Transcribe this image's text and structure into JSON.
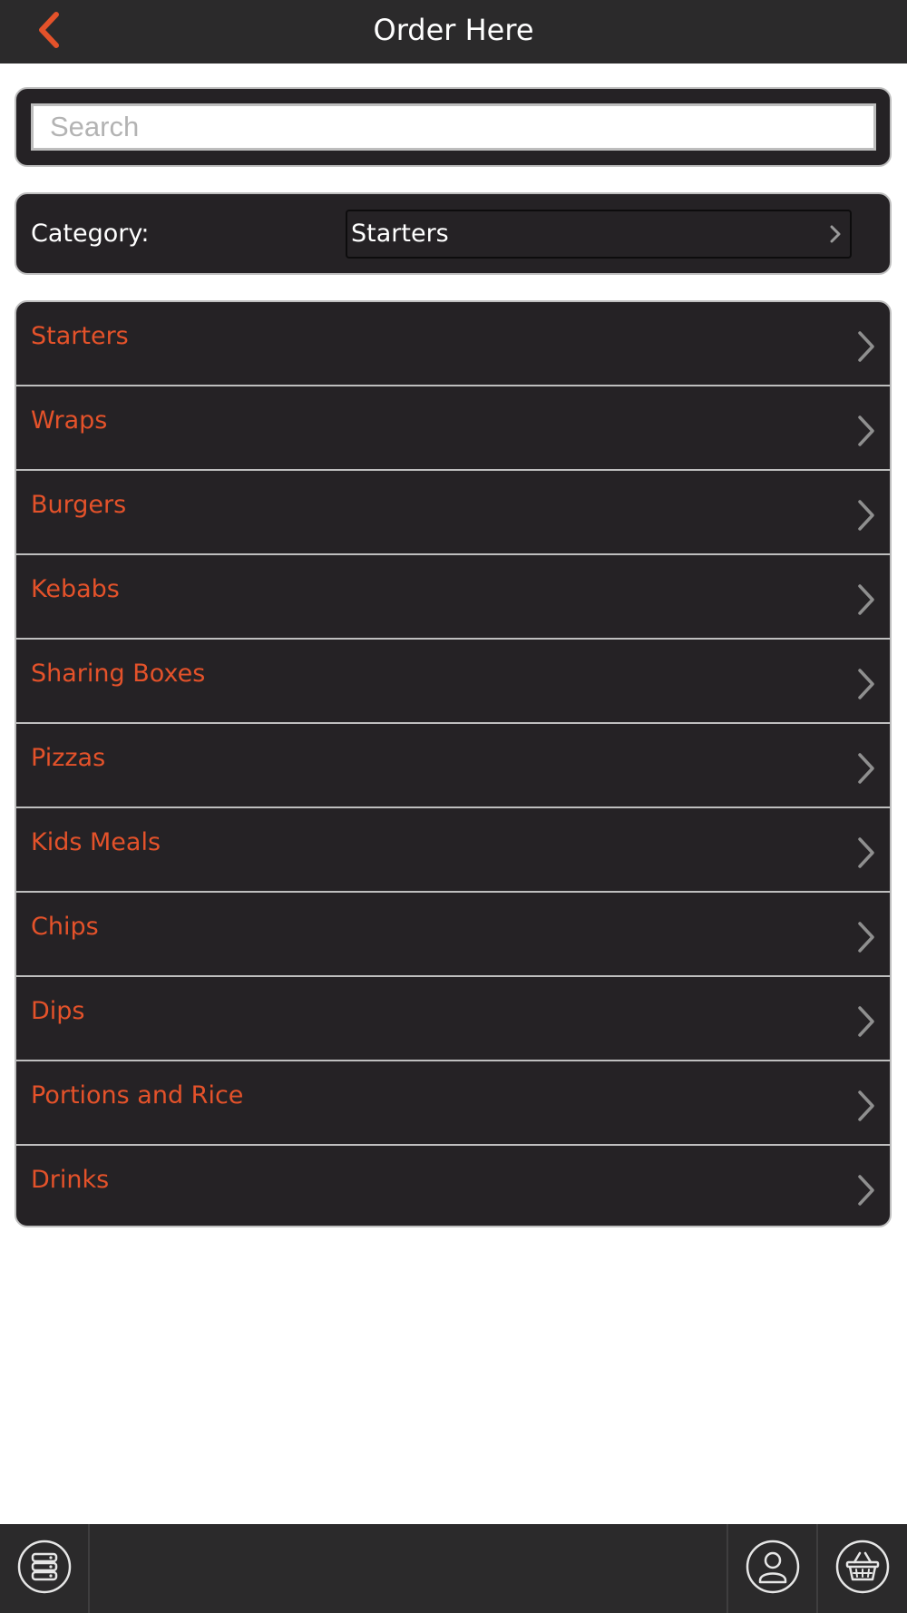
{
  "header": {
    "title": "Order Here",
    "back_icon": "chevron-left-icon",
    "accent_color": "#e4522a"
  },
  "search": {
    "placeholder": "Search",
    "value": ""
  },
  "category": {
    "label": "Category:",
    "selected": "Starters"
  },
  "menu": {
    "items": [
      {
        "label": "Starters"
      },
      {
        "label": "Wraps"
      },
      {
        "label": "Burgers"
      },
      {
        "label": "Kebabs"
      },
      {
        "label": "Sharing Boxes"
      },
      {
        "label": "Pizzas"
      },
      {
        "label": "Kids Meals"
      },
      {
        "label": "Chips"
      },
      {
        "label": "Dips"
      },
      {
        "label": "Portions and Rice"
      },
      {
        "label": "Drinks"
      }
    ]
  },
  "bottom_bar": {
    "left_icon": "menu-list-icon",
    "account_icon": "user-account-icon",
    "basket_icon": "shopping-basket-icon"
  },
  "colors": {
    "bar_background": "#2b2a2b",
    "panel_background": "#252225",
    "item_text": "#e4522a",
    "divider": "#bfbfbf"
  }
}
